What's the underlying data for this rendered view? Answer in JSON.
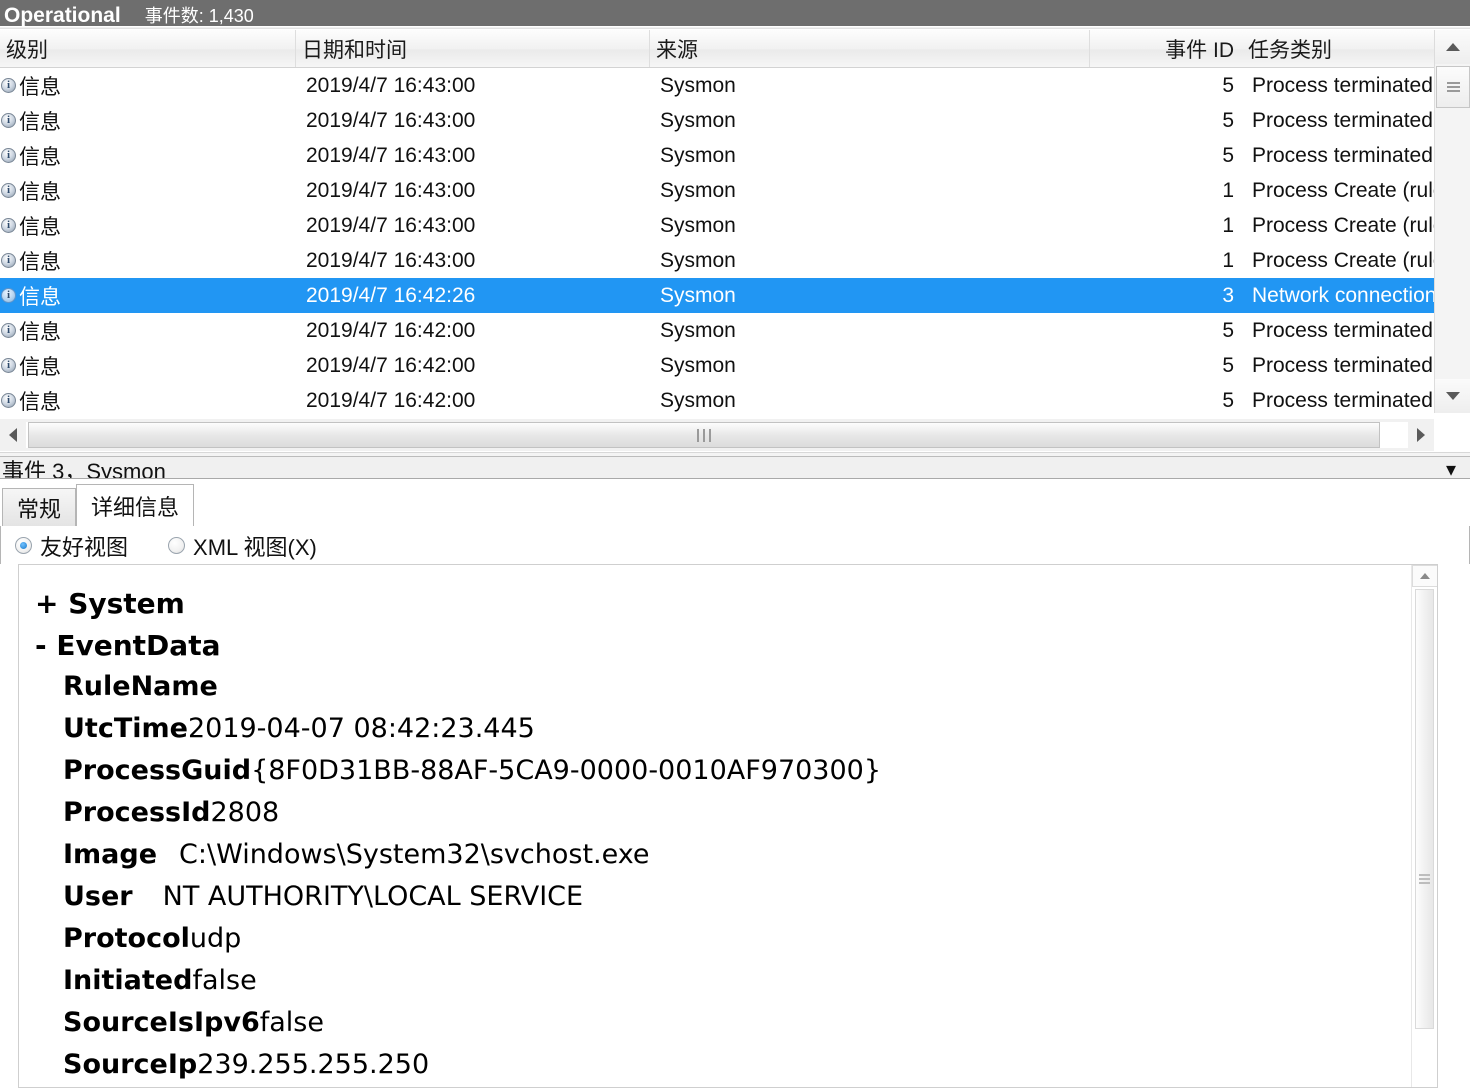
{
  "titlebar": {
    "log_name": "Operational",
    "event_count_label": "事件数: 1,430"
  },
  "event_list": {
    "columns": [
      "级别",
      "日期和时间",
      "来源",
      "事件 ID",
      "任务类别"
    ],
    "rows": [
      {
        "level": "信息",
        "icon": "information-icon",
        "date": "2019/4/7 16:43:00",
        "source": "Sysmon",
        "event_id": "5",
        "task": "Process terminated (..",
        "selected": false
      },
      {
        "level": "信息",
        "icon": "information-icon",
        "date": "2019/4/7 16:43:00",
        "source": "Sysmon",
        "event_id": "5",
        "task": "Process terminated (..",
        "selected": false
      },
      {
        "level": "信息",
        "icon": "information-icon",
        "date": "2019/4/7 16:43:00",
        "source": "Sysmon",
        "event_id": "5",
        "task": "Process terminated (..",
        "selected": false
      },
      {
        "level": "信息",
        "icon": "information-icon",
        "date": "2019/4/7 16:43:00",
        "source": "Sysmon",
        "event_id": "1",
        "task": "Process Create (rule:..",
        "selected": false
      },
      {
        "level": "信息",
        "icon": "information-icon",
        "date": "2019/4/7 16:43:00",
        "source": "Sysmon",
        "event_id": "1",
        "task": "Process Create (rule:..",
        "selected": false
      },
      {
        "level": "信息",
        "icon": "information-icon",
        "date": "2019/4/7 16:43:00",
        "source": "Sysmon",
        "event_id": "1",
        "task": "Process Create (rule:..",
        "selected": false
      },
      {
        "level": "信息",
        "icon": "information-icon",
        "date": "2019/4/7 16:42:26",
        "source": "Sysmon",
        "event_id": "3",
        "task": "Network connection..",
        "selected": true
      },
      {
        "level": "信息",
        "icon": "information-icon",
        "date": "2019/4/7 16:42:00",
        "source": "Sysmon",
        "event_id": "5",
        "task": "Process terminated (..",
        "selected": false
      },
      {
        "level": "信息",
        "icon": "information-icon",
        "date": "2019/4/7 16:42:00",
        "source": "Sysmon",
        "event_id": "5",
        "task": "Process terminated (..",
        "selected": false
      },
      {
        "level": "信息",
        "icon": "information-icon",
        "date": "2019/4/7 16:42:00",
        "source": "Sysmon",
        "event_id": "5",
        "task": "Process terminated (..",
        "selected": false
      }
    ]
  },
  "detail_pane": {
    "title": "事件 3，Sysmon",
    "collapse_icon": "chevron-down-icon",
    "tabs": [
      {
        "label": "常规",
        "active": false
      },
      {
        "label": "详细信息",
        "active": true
      }
    ],
    "view_modes": [
      {
        "label": "友好视图",
        "selected": true
      },
      {
        "label": "XML 视图(X)",
        "selected": false
      }
    ],
    "nodes": [
      {
        "marker": "+",
        "name": "System"
      },
      {
        "marker": "-",
        "name": "EventData"
      }
    ],
    "fields": [
      {
        "key": "RuleName",
        "value": ""
      },
      {
        "key": "UtcTime",
        "value": "2019-04-07 08:42:23.445"
      },
      {
        "key": "ProcessGuid",
        "value": "{8F0D31BB-88AF-5CA9-0000-0010AF970300}"
      },
      {
        "key": "ProcessId",
        "value": "2808"
      },
      {
        "key": "Image",
        "value": "C:\\Windows\\System32\\svchost.exe"
      },
      {
        "key": "User",
        "value": "NT AUTHORITY\\LOCAL SERVICE"
      },
      {
        "key": "Protocol",
        "value": "udp"
      },
      {
        "key": "Initiated",
        "value": "false"
      },
      {
        "key": "SourceIsIpv6",
        "value": "false"
      },
      {
        "key": "SourceIp",
        "value": "239.255.255.250"
      }
    ]
  },
  "colors": {
    "selection_blue": "#2196f3",
    "titlebar_gray": "#6e6e6e"
  }
}
